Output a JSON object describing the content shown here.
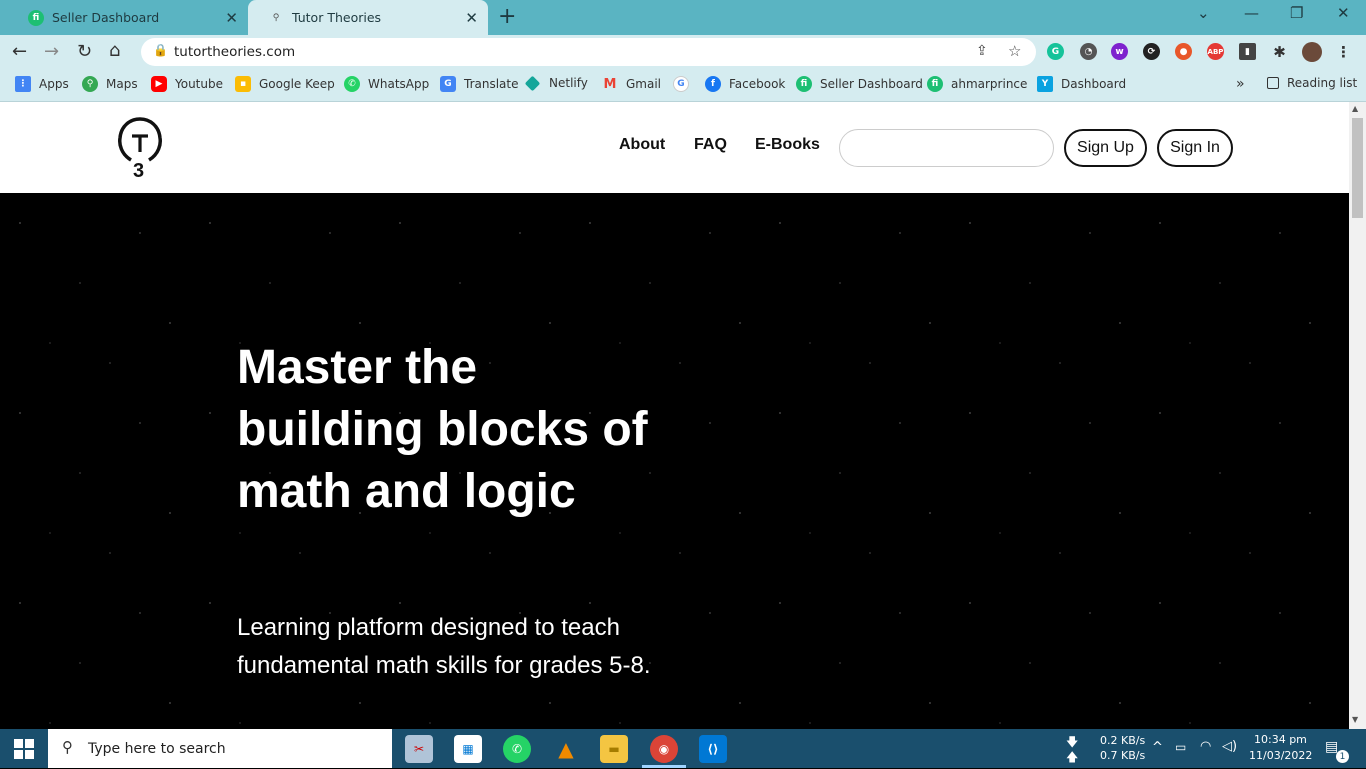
{
  "browser": {
    "tabs": [
      {
        "label": "Seller Dashboard",
        "active": false
      },
      {
        "label": "Tutor Theories",
        "active": true
      }
    ],
    "url": "tutortheories.com",
    "bookmarks": [
      {
        "label": "Apps",
        "icon": "apps-grid-icon",
        "color": "#e53935"
      },
      {
        "label": "Maps",
        "icon": "maps-pin-icon",
        "color": "#34a853"
      },
      {
        "label": "Youtube",
        "icon": "youtube-icon",
        "color": "#ff0000"
      },
      {
        "label": "Google Keep",
        "icon": "keep-icon",
        "color": "#fbbc04"
      },
      {
        "label": "WhatsApp",
        "icon": "whatsapp-icon",
        "color": "#25d366"
      },
      {
        "label": "Translate",
        "icon": "translate-icon",
        "color": "#4285f4"
      },
      {
        "label": "Netlify",
        "icon": "netlify-icon",
        "color": "#15a69a"
      },
      {
        "label": "Gmail",
        "icon": "gmail-icon",
        "color": "#ea4335"
      },
      {
        "label": "",
        "icon": "google-icon",
        "color": "#4285f4"
      },
      {
        "label": "Facebook",
        "icon": "facebook-icon",
        "color": "#1877f2"
      },
      {
        "label": "Seller Dashboard",
        "icon": "fiverr-icon",
        "color": "#1dbf73"
      },
      {
        "label": "ahmarprince",
        "icon": "fiverr-icon",
        "color": "#1dbf73"
      },
      {
        "label": "Dashboard",
        "icon": "dashboard-icon",
        "color": "#0aa2e0"
      }
    ],
    "reading_list": "Reading list",
    "more_bookmarks": "»"
  },
  "site": {
    "logo_letters": "T3",
    "nav": [
      {
        "label": "About"
      },
      {
        "label": "FAQ"
      },
      {
        "label": "E-Books"
      }
    ],
    "search_placeholder": "",
    "sign_up": "Sign Up",
    "sign_in": "Sign In",
    "hero": {
      "title": "Master the building blocks of math and logic",
      "subtitle": "Learning platform designed to teach fundamental math skills for grades 5-8."
    }
  },
  "taskbar": {
    "search_placeholder": "Type here to search",
    "net_down": "0.2 KB/s",
    "net_up": "0.7 KB/s",
    "time": "10:34 pm",
    "date": "11/03/2022",
    "notifications": "1"
  }
}
